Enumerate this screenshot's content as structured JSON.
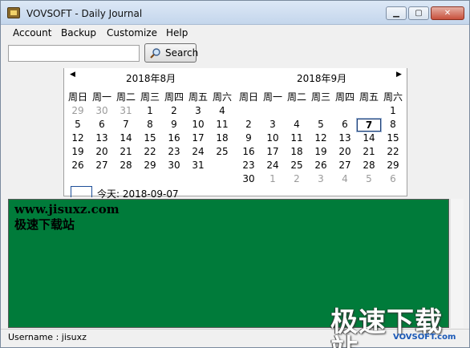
{
  "window": {
    "title": "VOVSOFT - Daily Journal"
  },
  "menu": [
    "Account",
    "Backup",
    "Customize",
    "Help"
  ],
  "toolbar": {
    "search_value": "",
    "search_label": "Search"
  },
  "calendar": {
    "weekdays": [
      "周日",
      "周一",
      "周二",
      "周三",
      "周四",
      "周五",
      "周六"
    ],
    "months": [
      {
        "title": "2018年8月",
        "weeks": [
          [
            "29",
            "30",
            "31",
            "1",
            "2",
            "3",
            "4"
          ],
          [
            "5",
            "6",
            "7",
            "8",
            "9",
            "10",
            "11"
          ],
          [
            "12",
            "13",
            "14",
            "15",
            "16",
            "17",
            "18"
          ],
          [
            "19",
            "20",
            "21",
            "22",
            "23",
            "24",
            "25"
          ],
          [
            "26",
            "27",
            "28",
            "29",
            "30",
            "31",
            ""
          ]
        ],
        "other_month_cells": [
          "0-0",
          "0-1",
          "0-2"
        ]
      },
      {
        "title": "2018年9月",
        "weeks": [
          [
            "",
            "",
            "",
            "",
            "",
            "",
            "1"
          ],
          [
            "2",
            "3",
            "4",
            "5",
            "6",
            "7",
            "8"
          ],
          [
            "9",
            "10",
            "11",
            "12",
            "13",
            "14",
            "15"
          ],
          [
            "16",
            "17",
            "18",
            "19",
            "20",
            "21",
            "22"
          ],
          [
            "23",
            "24",
            "25",
            "26",
            "27",
            "28",
            "29"
          ],
          [
            "30",
            "1",
            "2",
            "3",
            "4",
            "5",
            "6"
          ]
        ],
        "other_month_cells": [
          "5-1",
          "5-2",
          "5-3",
          "5-4",
          "5-5",
          "5-6"
        ],
        "selected_cell": "1-5"
      }
    ],
    "today_label": "今天: 2018-09-07"
  },
  "editor": {
    "lines": [
      "www.jisuxz.com",
      "极速下载站"
    ],
    "background": "#007b3a"
  },
  "status": {
    "text": "Username : jisuxz"
  },
  "watermark": {
    "text": "极速下载站",
    "sub": "VOVSOFT.com"
  }
}
